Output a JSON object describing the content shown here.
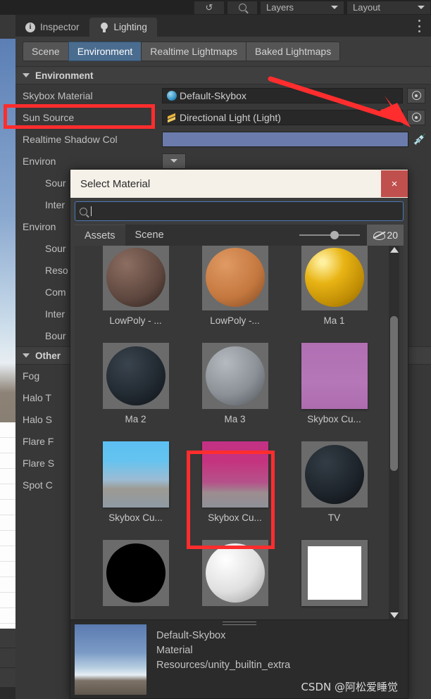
{
  "toolbar": {
    "history_icon": "history-icon",
    "search_icon": "search-icon",
    "layers_label": "Layers",
    "layout_label": "Layout"
  },
  "tabs": [
    {
      "label": "Inspector",
      "icon": "info-icon",
      "active": false
    },
    {
      "label": "Lighting",
      "icon": "lightbulb-icon",
      "active": true
    }
  ],
  "subtabs": [
    {
      "label": "Scene",
      "active": false
    },
    {
      "label": "Environment",
      "active": true
    },
    {
      "label": "Realtime Lightmaps",
      "active": false
    },
    {
      "label": "Baked Lightmaps",
      "active": false
    }
  ],
  "sections": [
    {
      "header": "Environment"
    },
    {
      "header": "Other"
    }
  ],
  "rows": [
    {
      "label": "Skybox Material",
      "value": "Default-Skybox",
      "icon": "sphere-icon",
      "control": "target"
    },
    {
      "label": "Sun Source",
      "value": "Directional Light (Light)",
      "icon": "light-icon",
      "control": "target"
    },
    {
      "label": "Realtime Shadow Col",
      "value": "",
      "control": "color-eyedropper"
    },
    {
      "label": "Environ",
      "value": "",
      "control": "dropdown"
    },
    {
      "label": "Sour",
      "value": "",
      "control": "dark"
    },
    {
      "label": "Inter",
      "value": "",
      "control": "none"
    },
    {
      "label": "Environ",
      "value": "",
      "control": "dropdown"
    },
    {
      "label": "Sour",
      "value": "",
      "control": "dropdown"
    },
    {
      "label": "Reso",
      "value": "",
      "control": "dropdown"
    },
    {
      "label": "Com",
      "value": "",
      "control": "dark"
    },
    {
      "label": "Inter",
      "value": "",
      "control": "dark"
    },
    {
      "label": "Bour",
      "value": "",
      "control": "none"
    },
    {
      "label": "Fog",
      "value": "",
      "control": "none"
    },
    {
      "label": "Halo T",
      "value": "",
      "control": "target"
    },
    {
      "label": "Halo S",
      "value": "",
      "control": "dark"
    },
    {
      "label": "Flare F",
      "value": "",
      "control": "dark"
    },
    {
      "label": "Flare S",
      "value": "",
      "control": "none"
    },
    {
      "label": "Spot C",
      "value": "",
      "control": "target"
    }
  ],
  "dialog": {
    "title": "Select Material",
    "close_label": "×",
    "search_value": "",
    "search_icon": "search-icon",
    "tabs": [
      {
        "label": "Assets",
        "active": true
      },
      {
        "label": "Scene",
        "active": false
      }
    ],
    "hidden_count": "20",
    "hidden_icon": "eye-off-icon",
    "items": [
      {
        "name": "LowPoly - ...",
        "shape": "sphere",
        "color": "#6b5249"
      },
      {
        "name": "LowPoly -...",
        "shape": "sphere",
        "color": "#c97c44"
      },
      {
        "name": "Ma 1",
        "shape": "sphere",
        "color": "#d4a309"
      },
      {
        "name": "Ma 2",
        "shape": "sphere",
        "color": "#1e242b"
      },
      {
        "name": "Ma 3",
        "shape": "sphere",
        "color": "#8f9499"
      },
      {
        "name": "Skybox Cu...",
        "shape": "square",
        "color": "#b771b8"
      },
      {
        "name": "Skybox Cu...",
        "shape": "sky-blue",
        "color": "#55bdf0"
      },
      {
        "name": "Skybox Cu...",
        "shape": "sky-pink",
        "color": "#c8317f"
      },
      {
        "name": "TV",
        "shape": "sphere",
        "color": "#1c2026"
      },
      {
        "name": "",
        "shape": "sphere",
        "color": "#000000"
      },
      {
        "name": "",
        "shape": "sphere",
        "color": "#e8e8e8"
      },
      {
        "name": "",
        "shape": "square",
        "color": "#ffffff"
      }
    ],
    "preview": {
      "name": "Default-Skybox",
      "type": "Material",
      "path": "Resources/unity_builtin_extra"
    }
  },
  "watermark": "CSDN @阿松爱睡觉",
  "colors": {
    "accent": "#4a6c8f",
    "annotation": "#ff2d2d",
    "close": "#c0504d",
    "shadow_color": "#6b7bab"
  }
}
